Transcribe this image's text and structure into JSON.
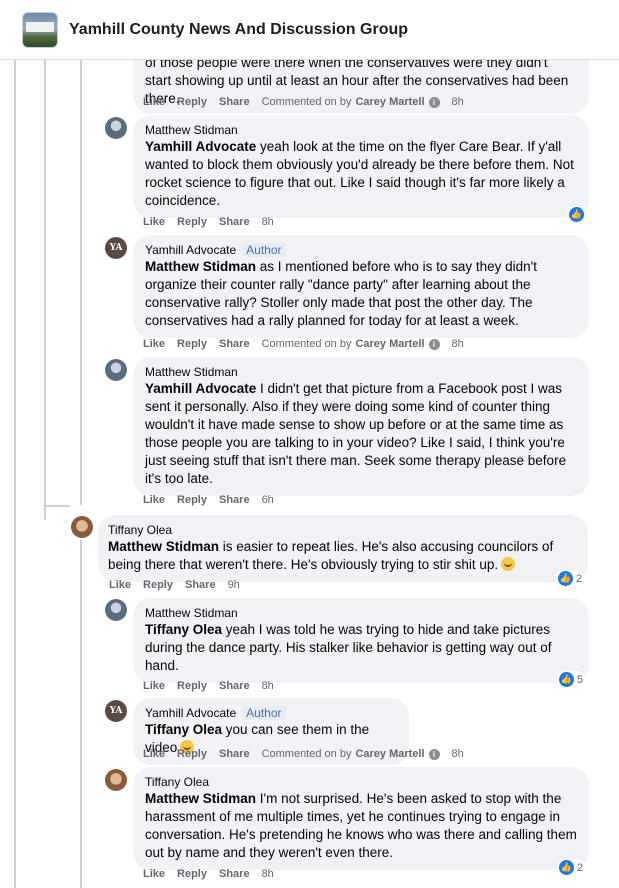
{
  "header": {
    "title": "Yamhill County News And Discussion Group"
  },
  "actions": {
    "like": "Like",
    "reply": "Reply",
    "share": "Share",
    "commented_on_by": "Commented on by"
  },
  "comments": [
    {
      "author": "",
      "text_start": "of those people were there when the conservatives were they didn't start showing up until at least an hour after the conservatives had been there.",
      "commented_by": "Carey Martell",
      "time": "8h"
    },
    {
      "author": "Matthew Stidman",
      "mention": "Yamhill Advocate",
      "text": " yeah look at the time on the flyer Care Bear. If y'all wanted to block them obviously you'd already be there before them. Not rocket science to figure that out. Like I said though it's far more likely a coincidence.",
      "time": "8h"
    },
    {
      "author": "Yamhill Advocate",
      "badge": "Author",
      "mention": "Matthew Stidman",
      "text": " as I mentioned before who is to say they didn't organize their counter rally \"dance party\" after learning about the conservative rally? Stoller only made that post the other day. The conservatives had a rally planned for today for at least a week.",
      "commented_by": "Carey Martell",
      "time": "8h"
    },
    {
      "author": "Matthew Stidman",
      "mention": "Yamhill Advocate",
      "text": " I didn't get that picture from a Facebook post I was sent it personally. Also if they were doing some kind of counter thing wouldn't it have made sense to show up before or at the same time as those people you are talking to in your video? Like I said, I think you're just seeing stuff that isn't there man. Seek some therapy please before it's too late.",
      "time": "6h"
    },
    {
      "author": "Tiffany Olea",
      "mention": "Matthew Stidman",
      "text": " is easier to repeat lies. He's also accusing councilors of being there that weren't there. He's obviously trying to stir shit up.",
      "time": "9h",
      "reactions": "2"
    },
    {
      "author": "Matthew Stidman",
      "mention": "Tiffany Olea",
      "text": " yeah I was told he was trying to hide and take pictures during the dance party. His stalker like behavior is getting way out of hand.",
      "time": "8h",
      "reactions": "5"
    },
    {
      "author": "Yamhill Advocate",
      "badge": "Author",
      "mention": "Tiffany Olea",
      "text": " you can see them in the video",
      "commented_by": "Carey Martell",
      "time": "8h"
    },
    {
      "author": "Tiffany Olea",
      "mention": "Matthew Stidman",
      "text": " I'm not surprised. He's been asked to stop with the harassment of me multiple times, yet he continues trying to engage in conversation. He's pretending he knows who was there and calling them out by name and they weren't even there.",
      "time": "8h",
      "reactions": "2"
    }
  ],
  "avatars": {
    "yamhill_initials": "YA"
  }
}
